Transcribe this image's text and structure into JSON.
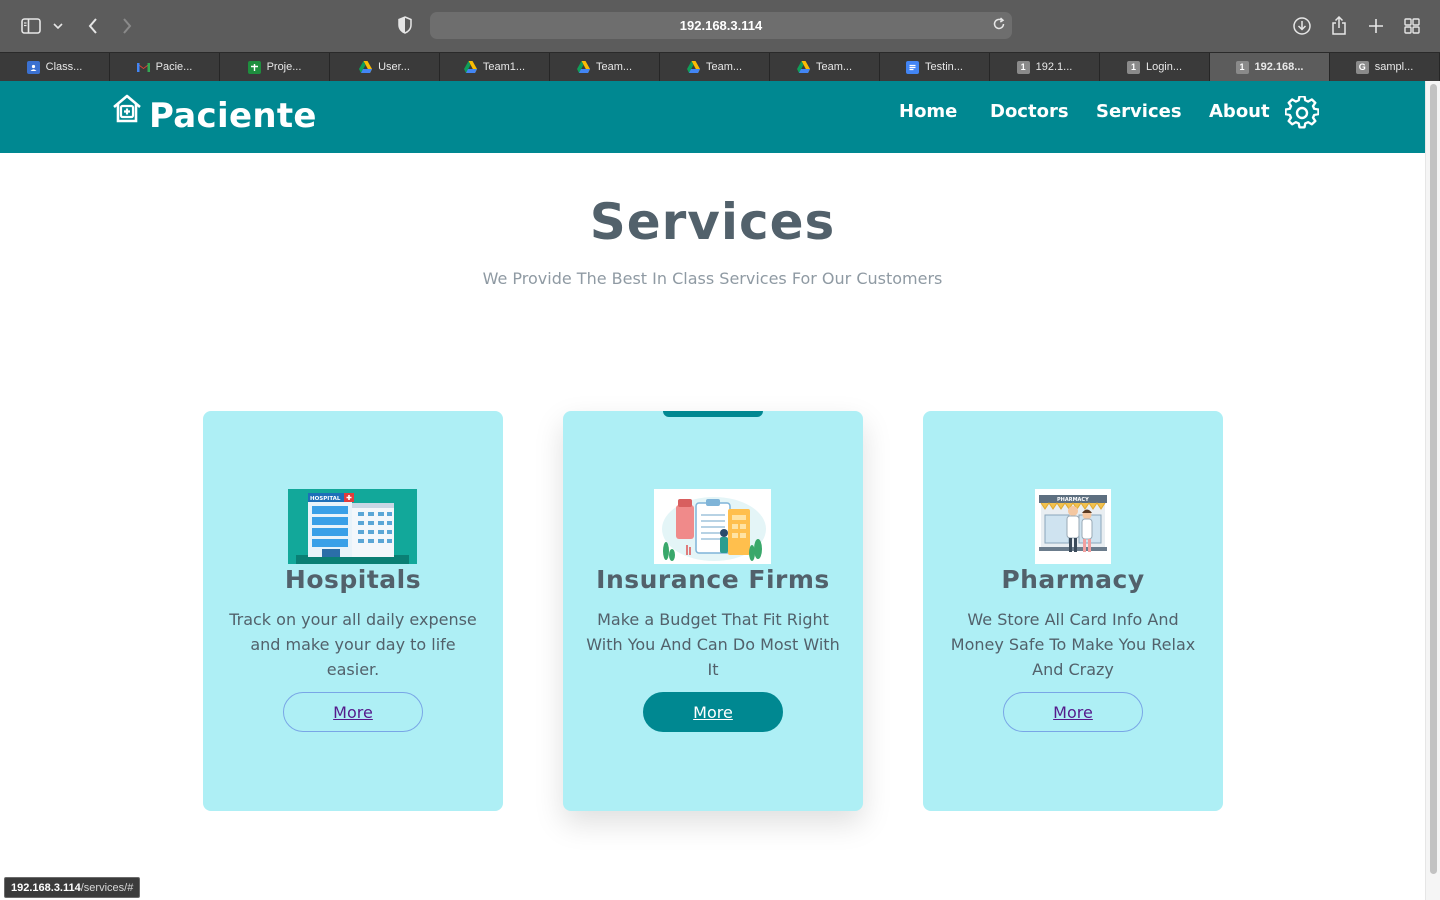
{
  "browser": {
    "url": "192.168.3.114",
    "tabs": [
      {
        "label": "Class...",
        "icon": "classroom-icon",
        "color": "#3b71d1"
      },
      {
        "label": "Pacie...",
        "icon": "gmail-icon",
        "color": "#ea4335"
      },
      {
        "label": "Proje...",
        "icon": "sheets-icon",
        "color": "#1e8e3e"
      },
      {
        "label": "User...",
        "icon": "drive-icon",
        "color": "#fbbc04"
      },
      {
        "label": "Team1...",
        "icon": "drive-icon",
        "color": "#fbbc04"
      },
      {
        "label": "Team...",
        "icon": "drive-icon",
        "color": "#fbbc04"
      },
      {
        "label": "Team...",
        "icon": "drive-icon",
        "color": "#fbbc04"
      },
      {
        "label": "Team...",
        "icon": "drive-icon",
        "color": "#fbbc04"
      },
      {
        "label": "Testin...",
        "icon": "docs-icon",
        "color": "#4285f4"
      },
      {
        "label": "192.1...",
        "icon": "number-icon",
        "color": "#8a8a8a",
        "glyph": "1"
      },
      {
        "label": "Login...",
        "icon": "number-icon",
        "color": "#8a8a8a",
        "glyph": "1"
      },
      {
        "label": "192.168...",
        "icon": "number-icon",
        "color": "#8a8a8a",
        "glyph": "1",
        "active": true
      },
      {
        "label": "sampl...",
        "icon": "g-icon",
        "color": "#8a8a8a",
        "glyph": "G"
      }
    ],
    "status_link_host": "192.168.3.114",
    "status_link_path": "/services/#"
  },
  "site": {
    "brand": "Paciente",
    "nav": {
      "home": "Home",
      "doctors": "Doctors",
      "services": "Services",
      "about": "About"
    },
    "title": "Services",
    "subtitle": "We Provide The Best In Class Services For Our Customers",
    "cards": [
      {
        "name": "Hospitals",
        "description": "Track on your all daily expense and make your day to life easier.",
        "button": "More",
        "image_label": "HOSPITAL"
      },
      {
        "name": "Insurance Firms",
        "description": "Make a Budget That Fit Right With You And Can Do Most With It",
        "button": "More"
      },
      {
        "name": "Pharmacy",
        "description": "We Store All Card Info And Money Safe To Make You Relax And Crazy",
        "button": "More",
        "image_label": "PHARMACY"
      }
    ]
  },
  "colors": {
    "primary": "#008891",
    "card_bg": "#aeeff5",
    "heading": "#52616b",
    "muted": "#8f9aa3"
  }
}
